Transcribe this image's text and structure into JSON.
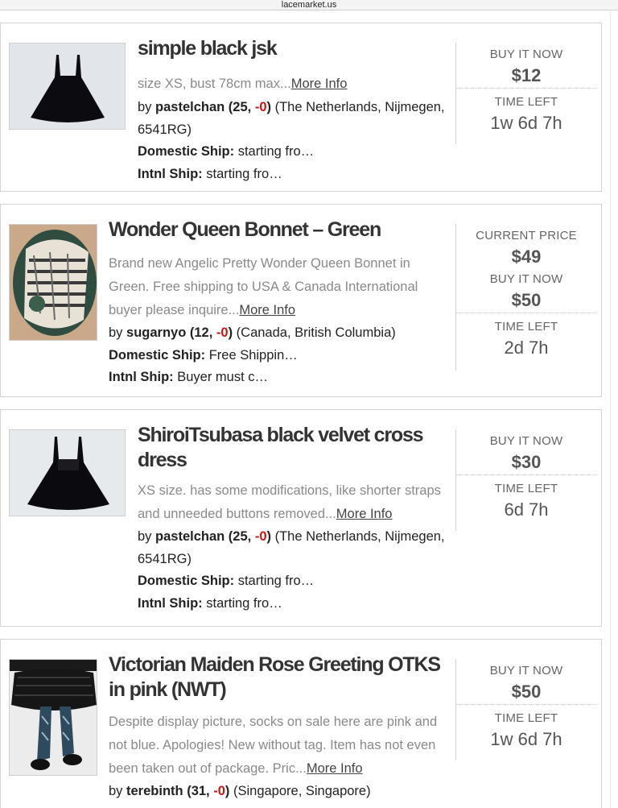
{
  "browser": {
    "url": "lacemarket.us"
  },
  "listings": [
    {
      "title": "simple black jsk",
      "desc": "size XS, bust 78cm max...",
      "more": "More Info",
      "by": "by ",
      "seller": "pastelchan",
      "rating_open": " (25, ",
      "rating_neg": "-0",
      "rating_close": ")",
      "location": " (The Netherlands, Nijmegen, 6541RG)",
      "domestic_label": "Domestic Ship:",
      "domestic_value": " starting fro…",
      "intl_label": "Intnl Ship:",
      "intl_value": " starting fro…",
      "price1_label": "BUY IT NOW",
      "price1_value": "$12",
      "time_label": "TIME LEFT",
      "time_value": "1w 6d 7h"
    },
    {
      "title": "Wonder Queen Bonnet – Green",
      "desc": "Brand new Angelic Pretty Wonder Queen Bonnet in Green. Free shipping to USA & Canada International buyer please inquire...",
      "more": "More Info",
      "by": "by ",
      "seller": "sugarnyo",
      "rating_open": " (12, ",
      "rating_neg": "-0",
      "rating_close": ")",
      "location": " (Canada, British Columbia)",
      "domestic_label": "Domestic Ship:",
      "domestic_value": " Free Shippin…",
      "intl_label": "Intnl Ship:",
      "intl_value": " Buyer must c…",
      "price0_label": "CURRENT PRICE",
      "price0_value": "$49",
      "price1_label": "BUY IT NOW",
      "price1_value": "$50",
      "time_label": "TIME LEFT",
      "time_value": "2d 7h"
    },
    {
      "title": "ShiroiTsubasa black velvet cross dress",
      "desc": "XS size. has some modifications, like shorter straps and unneeded buttons removed...",
      "more": "More Info",
      "by": "by ",
      "seller": "pastelchan",
      "rating_open": " (25, ",
      "rating_neg": "-0",
      "rating_close": ")",
      "location": " (The Netherlands, Nijmegen, 6541RG)",
      "domestic_label": "Domestic Ship:",
      "domestic_value": " starting fro…",
      "intl_label": "Intnl Ship:",
      "intl_value": " starting fro…",
      "price1_label": "BUY IT NOW",
      "price1_value": "$30",
      "time_label": "TIME LEFT",
      "time_value": "6d 7h"
    },
    {
      "title": "Victorian Maiden Rose Greeting OTKS in pink (NWT)",
      "desc": "Despite display picture, socks on sale here are pink and not blue. Apologies! New without tag. Item has not even been taken out of package. Pric...",
      "more": "More Info",
      "by": "by ",
      "seller": "terebinth",
      "rating_open": " (31, ",
      "rating_neg": "-0",
      "rating_close": ")",
      "location": " (Singapore, Singapore)",
      "price1_label": "BUY IT NOW",
      "price1_value": "$50",
      "time_label": "TIME LEFT",
      "time_value": "1w 6d 7h"
    }
  ]
}
